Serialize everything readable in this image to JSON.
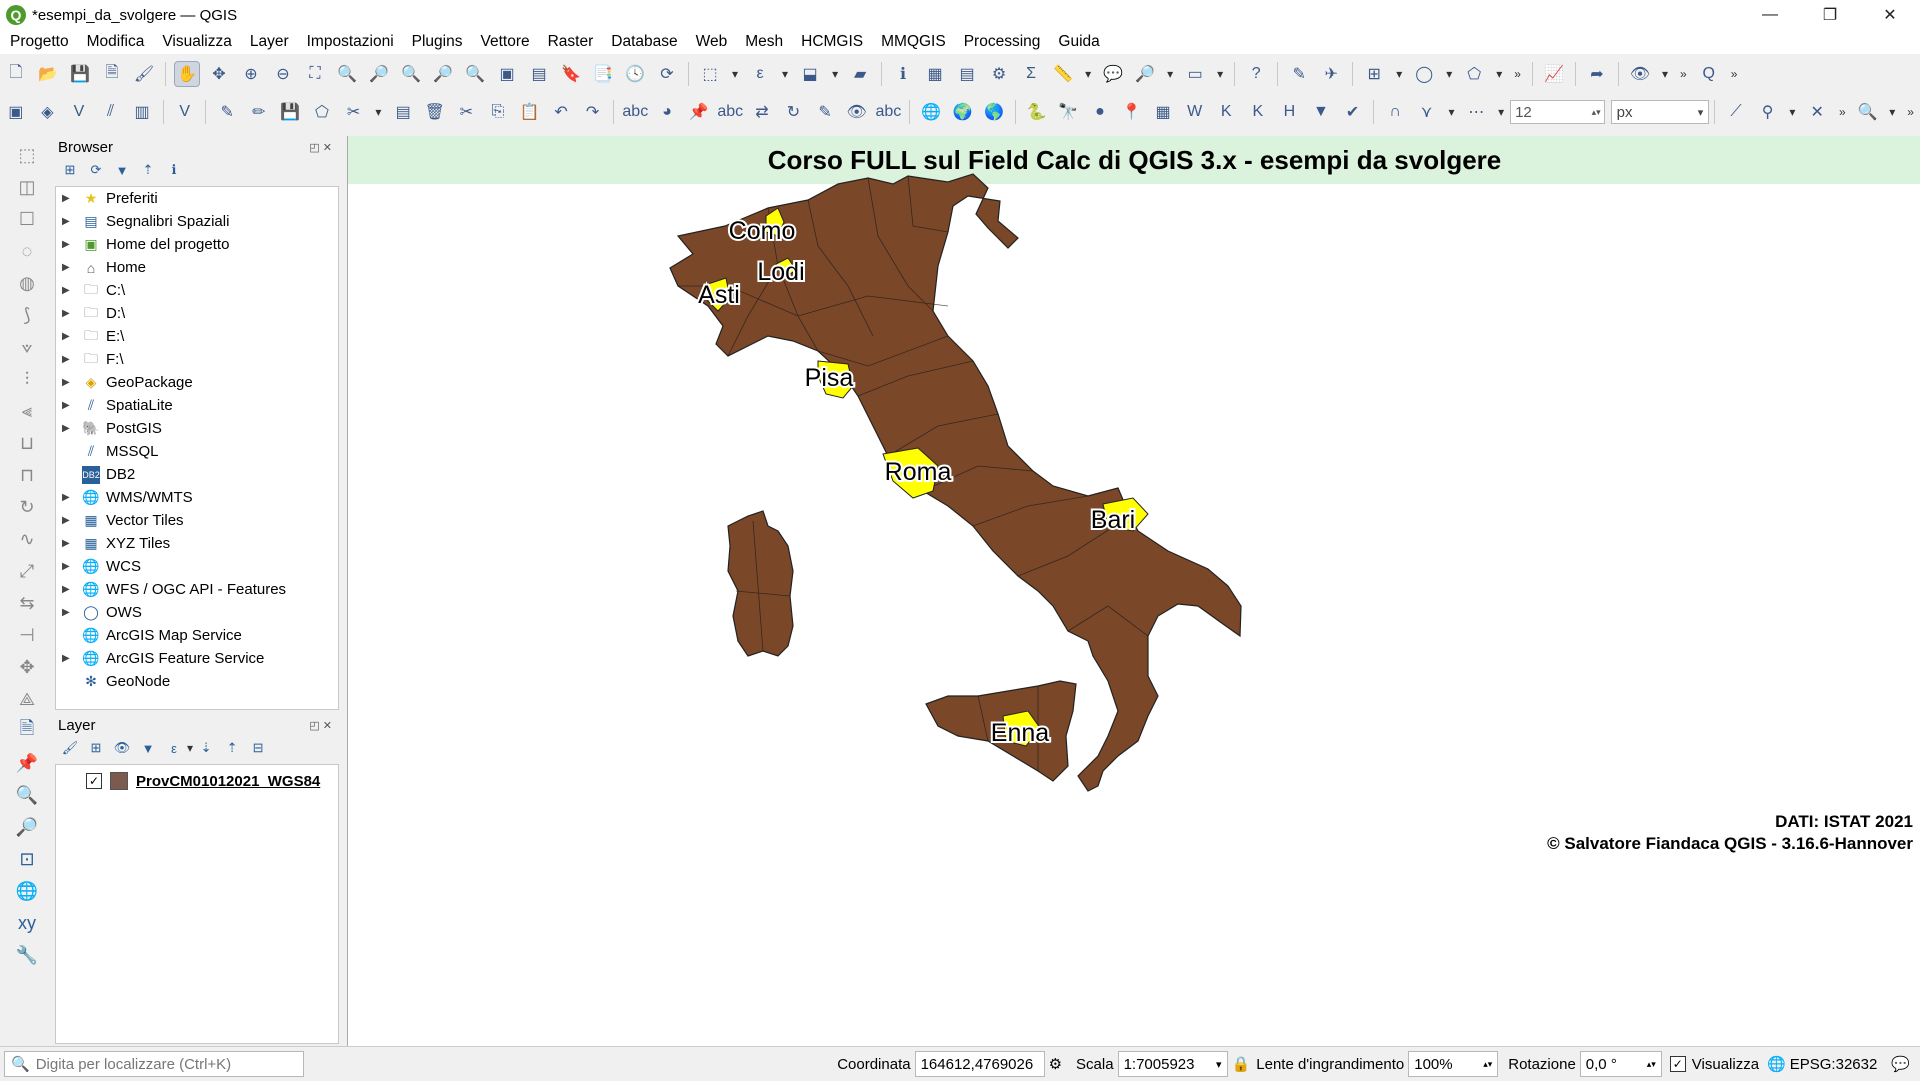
{
  "window": {
    "title": "*esempi_da_svolgere — QGIS"
  },
  "menu": [
    "Progetto",
    "Modifica",
    "Visualizza",
    "Layer",
    "Impostazioni",
    "Plugins",
    "Vettore",
    "Raster",
    "Database",
    "Web",
    "Mesh",
    "HCMGIS",
    "MMQGIS",
    "Processing",
    "Guida"
  ],
  "toolbar2": {
    "size_value": "12",
    "unit_value": "px"
  },
  "browser": {
    "title": "Browser",
    "items": [
      "Preferiti",
      "Segnalibri Spaziali",
      "Home del progetto",
      "Home",
      "C:\\",
      "D:\\",
      "E:\\",
      "F:\\",
      "GeoPackage",
      "SpatiaLite",
      "PostGIS",
      "MSSQL",
      "DB2",
      "WMS/WMTS",
      "Vector Tiles",
      "XYZ Tiles",
      "WCS",
      "WFS / OGC API - Features",
      "OWS",
      "ArcGIS Map Service",
      "ArcGIS Feature Service",
      "GeoNode"
    ]
  },
  "layers": {
    "title": "Layer",
    "items": [
      {
        "name": "ProvCM01012021_WGS84",
        "checked": true,
        "color": "#7c5a4e"
      }
    ]
  },
  "map": {
    "title": "Corso FULL sul Field Calc di QGIS 3.x - esempi da svolgere",
    "fill_color": "#7a4728",
    "highlight_color": "#ffff00",
    "labels": [
      "Como",
      "Lodi",
      "Asti",
      "Pisa",
      "Roma",
      "Bari",
      "Enna"
    ],
    "credit_line1": "DATI: ISTAT 2021",
    "credit_line2": "© Salvatore Fiandaca QGIS - 3.16.6-Hannover"
  },
  "status": {
    "locator_placeholder": "Digita per localizzare (Ctrl+K)",
    "coord_label": "Coordinata",
    "coord_value": "164612,4769026",
    "scale_label": "Scala",
    "scale_value": "1:7005923",
    "magnifier_label": "Lente d'ingrandimento",
    "magnifier_value": "100%",
    "rotation_label": "Rotazione",
    "rotation_value": "0,0 °",
    "render_label": "Visualizza",
    "crs": "EPSG:32632"
  }
}
